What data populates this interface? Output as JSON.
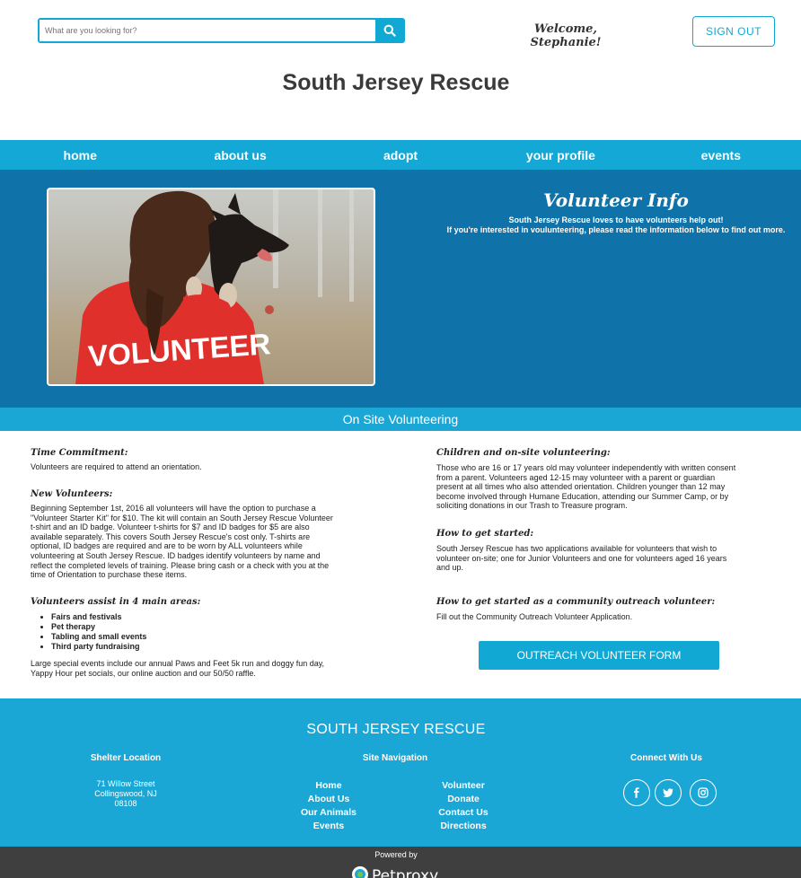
{
  "header": {
    "search_placeholder": "What are you looking for?",
    "welcome": "Welcome, Stephanie!",
    "signout": "SIGN OUT",
    "site_title": "South Jersey Rescue"
  },
  "nav": [
    "home",
    "about us",
    "adopt",
    "your profile",
    "events"
  ],
  "hero": {
    "image_caption": "VOLUNTEER",
    "title": "Volunteer Info",
    "line1": "South Jersey Rescue loves to have volunteers help out!",
    "line2": "If you're interested in voulunteering, please read the information below to find out more."
  },
  "section_bar": "On Site Volunteering",
  "left": {
    "time_h": "Time Commitment:",
    "time_p": "Volunteers are required to attend an orientation.",
    "new_h": "New Volunteers:",
    "new_p": [
      "Beginning September 1st, 2016 all volunteers will have the option to purchase a",
      "\"Volunteer Starter Kit\" for $10. The kit will contain an South Jersey Rescue Volunteer",
      "t-shirt and an ID badge. Volunteer t-shirts for $7 and ID badges for $5 are also",
      "available separately. This covers South Jersey Rescue's cost only. T-shirts are",
      "optional, ID badges are required and are to be worn by ALL volunteers while",
      "volunteering at South Jersey Rescue. ID badges identify volunteers by name and",
      "reflect the completed levels of training. Please bring cash or a check with you at the",
      "time of Orientation to purchase these items."
    ],
    "areas_h": "Volunteers assist in 4 main areas:",
    "areas": [
      "Fairs and festivals",
      "Pet therapy",
      "Tabling and small events",
      "Third party fundraising"
    ],
    "events_p": [
      "Large special events include our annual Paws and Feet 5k run and doggy fun day,",
      "Yappy Hour pet socials, our online auction and our 50/50 raffle."
    ]
  },
  "right": {
    "children_h": "Children and on-site volunteering:",
    "children_p": [
      "Those who are 16 or 17 years old may volunteer independently with written consent",
      "from a parent. Volunteers aged 12-15 may volunteer with a parent or guardian",
      "present at all times who also attended orientation. Children younger than 12 may",
      "become involved through Humane Education, attending our Summer Camp, or by",
      "soliciting donations in our Trash to Treasure program."
    ],
    "start_h": "How to get started:",
    "start_p": [
      "South Jersey Rescue has two applications available for volunteers that wish to",
      "volunteer on-site; one for Junior Volunteers and one for volunteers aged 16 years",
      "and up."
    ],
    "outreach_h": "How to get started as a community outreach volunteer:",
    "outreach_p": "Fill out the Community Outreach Volunteer Application.",
    "cta": "OUTREACH VOLUNTEER FORM"
  },
  "footer": {
    "title": "SOUTH JERSEY RESCUE",
    "shelter_h": "Shelter Location",
    "address": [
      "71 Willow Street",
      "Collingswood, NJ",
      "08108"
    ],
    "nav_h": "Site Navigation",
    "nav_col1": [
      "Home",
      "About Us",
      "Our Animals",
      "Events"
    ],
    "nav_col2": [
      "Volunteer",
      "Donate",
      "Contact Us",
      "Directions"
    ],
    "connect_h": "Connect With Us"
  },
  "powered": {
    "label": "Powered by",
    "brand": "Petproxy"
  },
  "colors": {
    "accent": "#14a8d6",
    "hero_bg": "#0f72a8",
    "powered_bg": "#3f3f3f"
  }
}
